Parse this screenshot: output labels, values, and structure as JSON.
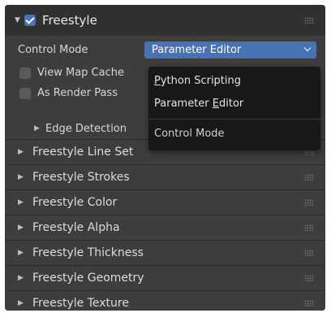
{
  "header": {
    "title": "Freestyle",
    "enabled": true
  },
  "settings": {
    "control_mode_label": "Control Mode",
    "control_mode_value": "Parameter Editor",
    "view_map_cache_label": "View Map Cache",
    "view_map_cache_checked": false,
    "as_render_pass_label": "As Render Pass",
    "as_render_pass_checked": false
  },
  "subpanel": {
    "label": "Edge Detection"
  },
  "sections": [
    {
      "label": "Freestyle Line Set"
    },
    {
      "label": "Freestyle Strokes"
    },
    {
      "label": "Freestyle Color"
    },
    {
      "label": "Freestyle Alpha"
    },
    {
      "label": "Freestyle Thickness"
    },
    {
      "label": "Freestyle Geometry"
    },
    {
      "label": "Freestyle Texture"
    }
  ],
  "dropdown": {
    "items": [
      {
        "pre": "",
        "u": "P",
        "post": "ython Scripting"
      },
      {
        "pre": "Parameter ",
        "u": "E",
        "post": "ditor"
      }
    ],
    "heading": "Control Mode"
  },
  "colors": {
    "accent": "#4772b3",
    "panel": "#3d3d3d",
    "header": "#303030",
    "menu": "#181818"
  },
  "icons": [
    "triangle-down-icon",
    "checkbox-checked-icon",
    "grip-icon",
    "triangle-right-icon",
    "chevron-down-icon"
  ]
}
